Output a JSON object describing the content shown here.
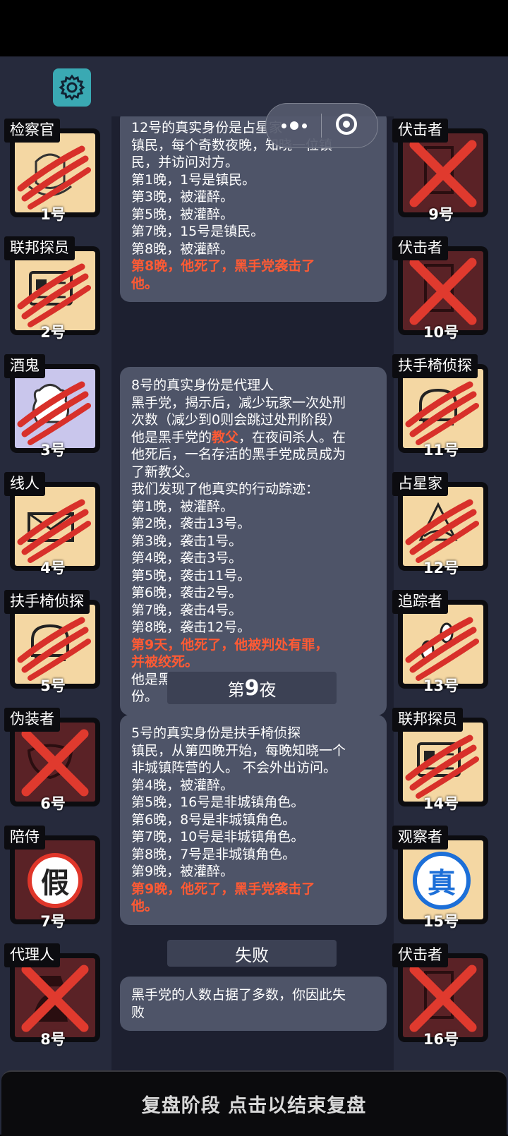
{
  "capsule": {
    "more_icon": "more-dots-icon",
    "close_icon": "target-close-icon"
  },
  "settings_icon": "gear-icon",
  "players_left": [
    {
      "role": "检察官",
      "number": "1号",
      "bg": "#f4d7a3",
      "mark": "claw",
      "art": "badge"
    },
    {
      "role": "联邦探员",
      "number": "2号",
      "bg": "#f4d7a3",
      "mark": "claw",
      "art": "id-card"
    },
    {
      "role": "酒鬼",
      "number": "3号",
      "bg": "#c9c6ec",
      "mark": "claw",
      "art": "bottle"
    },
    {
      "role": "线人",
      "number": "4号",
      "bg": "#f4d7a3",
      "mark": "claw",
      "art": "envelope"
    },
    {
      "role": "扶手椅侦探",
      "number": "5号",
      "bg": "#f4d7a3",
      "mark": "claw",
      "art": "armchair"
    },
    {
      "role": "伪装者",
      "number": "6号",
      "bg": "#5a2226",
      "mark": "x",
      "art": "mask"
    },
    {
      "role": "陪侍",
      "number": "7号",
      "bg": "#5a2226",
      "mark": "fake",
      "art": "none"
    },
    {
      "role": "代理人",
      "number": "8号",
      "bg": "#5a2226",
      "mark": "x",
      "art": "hat-man"
    }
  ],
  "players_right": [
    {
      "role": "伏击者",
      "number": "9号",
      "bg": "#5a2226",
      "mark": "x",
      "art": "door"
    },
    {
      "role": "伏击者",
      "number": "10号",
      "bg": "#5a2226",
      "mark": "x",
      "art": "door"
    },
    {
      "role": "扶手椅侦探",
      "number": "11号",
      "bg": "#f4d7a3",
      "mark": "claw",
      "art": "armchair"
    },
    {
      "role": "占星家",
      "number": "12号",
      "bg": "#f4d7a3",
      "mark": "claw",
      "art": "sextant"
    },
    {
      "role": "追踪者",
      "number": "13号",
      "bg": "#f4d7a3",
      "mark": "claw",
      "art": "footprints"
    },
    {
      "role": "联邦探员",
      "number": "14号",
      "bg": "#f4d7a3",
      "mark": "claw",
      "art": "id-card"
    },
    {
      "role": "观察者",
      "number": "15号",
      "bg": "#f4d7a3",
      "mark": "real",
      "art": "none"
    },
    {
      "role": "伏击者",
      "number": "16号",
      "bg": "#5a2226",
      "mark": "x",
      "art": "door"
    }
  ],
  "stamps": {
    "fake": "假",
    "real": "真"
  },
  "log": {
    "card1_lines": [
      {
        "text": "12号的真实身份是占星家",
        "red": false
      },
      {
        "text": "镇民，每个奇数夜晚，知晓一位镇",
        "red": false
      },
      {
        "text": "民，并访问对方。",
        "red": false
      },
      {
        "text": "第1晚，1号是镇民。",
        "red": false
      },
      {
        "text": "第3晚，被灌醉。",
        "red": false
      },
      {
        "text": "第5晚，被灌醉。",
        "red": false
      },
      {
        "text": "第7晚，15号是镇民。",
        "red": false
      },
      {
        "text": "第8晚，被灌醉。",
        "red": false
      },
      {
        "text": "第8晚，他死了，黑手党袭击了",
        "red": true
      },
      {
        "text": "他。",
        "red": true
      }
    ],
    "card2": {
      "line1": "8号的真实身份是代理人",
      "line2": "黑手党，揭示后，减少玩家一次处刑",
      "line3": "次数（减少到0则会跳过处刑阶段）",
      "line4_pre": "他是黑手党的",
      "line4_red": "教父",
      "line4_post": "，在夜间杀人。在",
      "line5": "他死后，一名存活的黑手党成员成为",
      "line6": "了新教父。",
      "line7": "我们发现了他真实的行动踪迹：",
      "nights": [
        "第1晚，被灌醉。",
        "第2晚，袭击13号。",
        "第3晚，袭击1号。",
        "第4晚，袭击3号。",
        "第5晚，袭击11号。",
        "第6晚，袭击2号。",
        "第7晚，袭击4号。",
        "第8晚，袭击12号。"
      ],
      "death1": "第9天，他死了，他被判处有罪，",
      "death2": "并被绞死。",
      "end1": "他是黑帮的代理人，不屑于伪装身",
      "end2": "份。"
    },
    "night_pre": "第",
    "night_num": "9",
    "night_post": "夜",
    "card3_lines": [
      {
        "text": "5号的真实身份是扶手椅侦探",
        "red": false
      },
      {
        "text": "镇民，从第四晚开始，每晚知晓一个",
        "red": false
      },
      {
        "text": "非城镇阵营的人。 不会外出访问。",
        "red": false
      },
      {
        "text": "第4晚，被灌醉。",
        "red": false
      },
      {
        "text": "第5晚，16号是非城镇角色。",
        "red": false
      },
      {
        "text": "第6晚，8号是非城镇角色。",
        "red": false
      },
      {
        "text": "第7晚，10号是非城镇角色。",
        "red": false
      },
      {
        "text": "第8晚，7号是非城镇角色。",
        "red": false
      },
      {
        "text": "第9晚，被灌醉。",
        "red": false
      },
      {
        "text": "第9晚，他死了，黑手党袭击了",
        "red": true
      },
      {
        "text": "他。",
        "red": true
      }
    ],
    "result_label": "失败",
    "result_line1": "黑手党的人数占据了多数，你因此失",
    "result_line2": "败"
  },
  "bottom_bar": "复盘阶段 点击以结束复盘"
}
